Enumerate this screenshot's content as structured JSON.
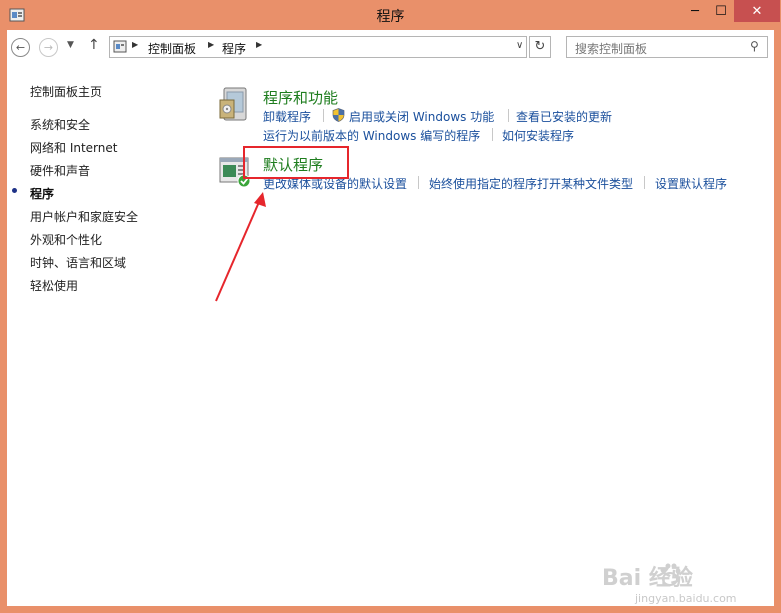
{
  "window": {
    "title": "程序",
    "minimize_glyph": "─",
    "maximize_glyph": "☐",
    "close_glyph": "✕"
  },
  "navbar": {
    "back_glyph": "←",
    "forward_glyph": "→",
    "dropdown_glyph": "▼",
    "up_glyph": "↑",
    "breadcrumb": [
      "控制面板",
      "程序"
    ],
    "breadcrumb_sep": "▶",
    "address_dropdown_glyph": "∨",
    "refresh_glyph": "↻",
    "search_placeholder": "搜索控制面板",
    "search_glyph": "⚲"
  },
  "sidebar": {
    "home": "控制面板主页",
    "items": [
      {
        "label": "系统和安全"
      },
      {
        "label": "网络和 Internet"
      },
      {
        "label": "硬件和声音"
      },
      {
        "label": "程序",
        "current": true
      },
      {
        "label": "用户帐户和家庭安全"
      },
      {
        "label": "外观和个性化"
      },
      {
        "label": "时钟、语言和区域"
      },
      {
        "label": "轻松使用"
      }
    ]
  },
  "sections": [
    {
      "title": "程序和功能",
      "icon": "programs-features-icon",
      "links_row1": [
        "卸载程序",
        "启用或关闭 Windows 功能",
        "查看已安装的更新"
      ],
      "links_row2": [
        "运行为以前版本的 Windows 编写的程序",
        "如何安装程序"
      ]
    },
    {
      "title": "默认程序",
      "icon": "default-programs-icon",
      "links_row1": [
        "更改媒体或设备的默认设置",
        "始终使用指定的程序打开某种文件类型",
        "设置默认程序"
      ]
    }
  ],
  "watermark": {
    "main": "Bai 经验",
    "sub": "jingyan.baidu.com"
  },
  "colors": {
    "titlebar": "#e9906a",
    "close_button": "#c75050",
    "link": "#1a4f9c",
    "section_title": "#1e7d1e",
    "highlight": "#e6262c"
  }
}
